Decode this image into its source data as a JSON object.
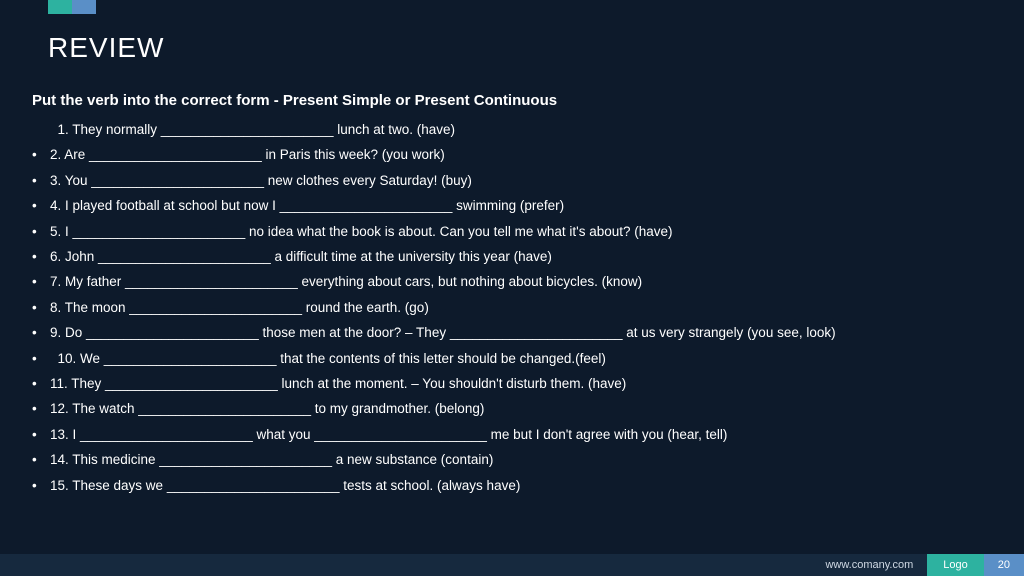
{
  "header": {
    "title": "REVIEW"
  },
  "instruction": "Put the verb into the correct form - Present Simple or Present Continuous",
  "questions": [
    {
      "bulleted": false,
      "text": "  1. They normally _______________________ lunch at two. (have)"
    },
    {
      "bulleted": true,
      "text": "2. Are _______________________ in Paris this week? (you work)"
    },
    {
      "bulleted": true,
      "text": "3. You _______________________ new clothes every Saturday! (buy)"
    },
    {
      "bulleted": true,
      "text": "4. I played football at school but now I _______________________ swimming (prefer)"
    },
    {
      "bulleted": true,
      "text": "5. I _______________________ no idea what the book is about. Can you tell me what it's about? (have)"
    },
    {
      "bulleted": true,
      "text": "6. John _______________________ a difficult time at the university this year (have)"
    },
    {
      "bulleted": true,
      "text": "7. My father _______________________ everything about cars, but nothing about bicycles. (know)"
    },
    {
      "bulleted": true,
      "text": "8. The moon _______________________ round the earth. (go)"
    },
    {
      "bulleted": true,
      "text": "9. Do _______________________ those men at the door? – They _______________________ at us very strangely (you see, look)"
    },
    {
      "bulleted": true,
      "text": "  10. We _______________________ that the contents of this letter should be changed.(feel)"
    },
    {
      "bulleted": true,
      "text": "11. They _______________________ lunch at the moment. – You shouldn't disturb them. (have)"
    },
    {
      "bulleted": true,
      "text": "12. The watch _______________________ to my grandmother. (belong)"
    },
    {
      "bulleted": true,
      "text": "13. I _______________________ what you _______________________ me but I don't agree with you (hear, tell)"
    },
    {
      "bulleted": true,
      "text": "14. This medicine _______________________ a new substance (contain)"
    },
    {
      "bulleted": true,
      "text": "15. These days we _______________________ tests at school. (always have)"
    }
  ],
  "footer": {
    "url": "www.comany.com",
    "logo": "Logo",
    "page": "20"
  }
}
